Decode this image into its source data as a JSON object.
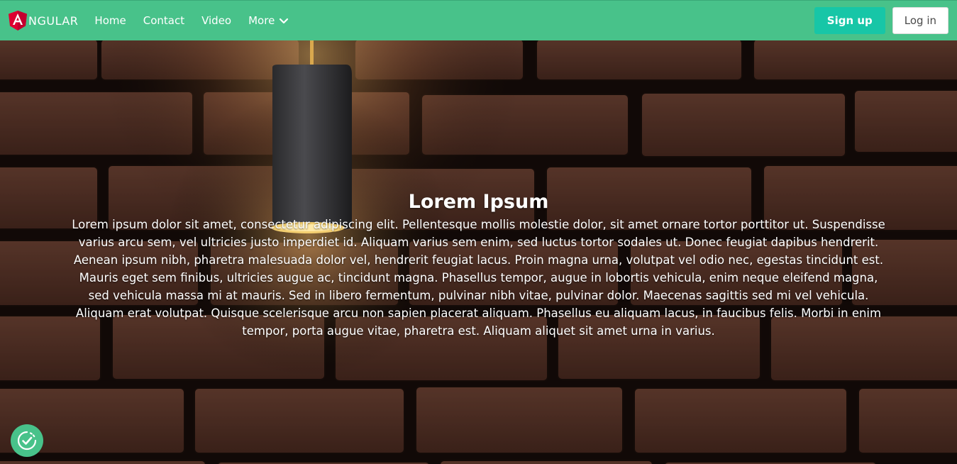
{
  "nav": {
    "logo_letter": "A",
    "logo_text": "NGULAR",
    "links": [
      "Home",
      "Contact",
      "Video"
    ],
    "more_label": "More",
    "signup_label": "Sign up",
    "login_label": "Log in"
  },
  "hero": {
    "title": "Lorem Ipsum",
    "text": "Lorem ipsum dolor sit amet, consectetur adipiscing elit. Pellentesque mollis molestie dolor, sit amet ornare tortor porttitor ut. Suspendisse varius arcu sem, vel ultricies justo imperdiet id. Aliquam varius sem enim, sed luctus tortor sodales ut. Donec feugiat dapibus hendrerit. Aenean ipsum nibh, pharetra malesuada dolor vel, hendrerit feugiat lacus. Proin magna urna, volutpat vel odio nec, egestas tincidunt est. Mauris eget sem finibus, ultricies augue ac, tincidunt magna. Phasellus tempor, augue in lobortis vehicula, enim neque eleifend magna, sed vehicula massa mi at mauris. Sed in libero fermentum, pulvinar nibh vitae, pulvinar dolor. Maecenas sagittis sed mi vel vehicula. Aliquam erat volutpat. Quisque scelerisque arcu non sapien placerat aliquam. Phasellus eu aliquam lacus, in faucibus felis. Morbi in enim tempor, porta augue vitae, pharetra est. Aliquam aliquet sit amet urna in varius."
  },
  "icons": {
    "logo": "angular-shield-icon",
    "chevron": "chevron-down-icon",
    "cookie": "cookie-consent-icon"
  },
  "colors": {
    "navbar": "#48c28a",
    "signup": "#17c6a7",
    "logo_red": "#dd0031"
  }
}
